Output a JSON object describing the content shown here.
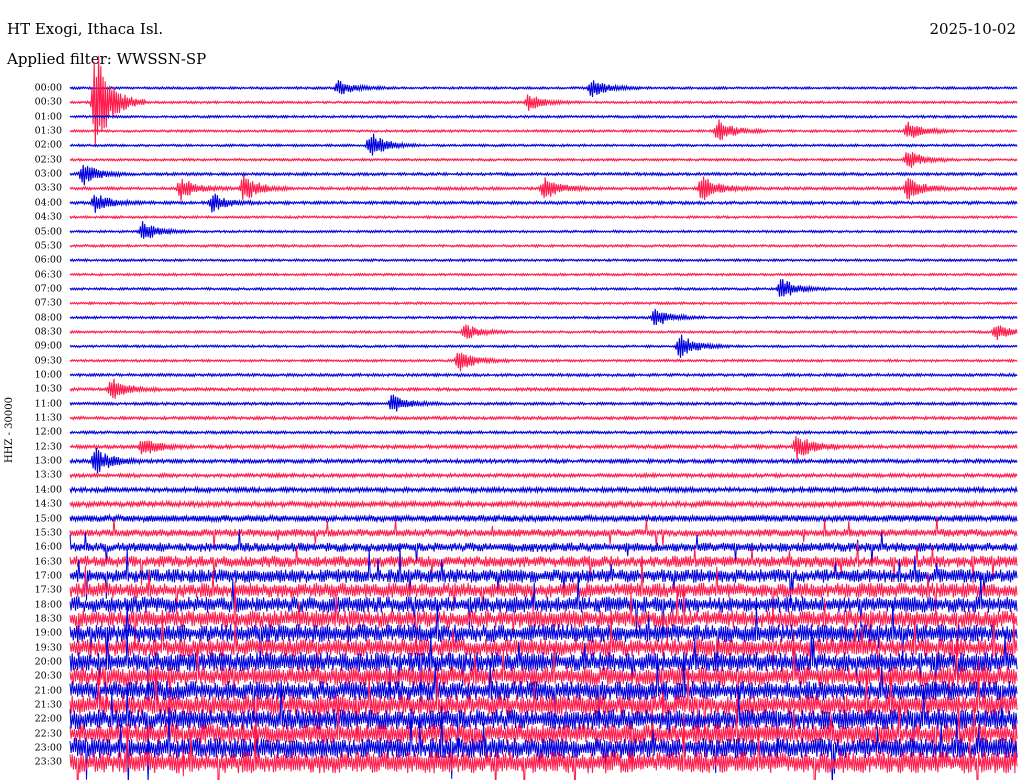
{
  "header": {
    "station": "HT Exogi, Ithaca Isl.",
    "date": "2025-10-02",
    "filter": "Applied filter: WWSSN-SP"
  },
  "channel_label": "HHZ - 30000",
  "colors": {
    "trace_a": "#0000dd",
    "trace_b": "#ff1a4a"
  },
  "chart_data": {
    "type": "line",
    "title": "HT Exogi, Ithaca Isl.",
    "x_axis": "minutes within each 30-minute line",
    "xlim": [
      0,
      30
    ],
    "line_labels": [
      "00:00",
      "00:30",
      "01:00",
      "01:30",
      "02:00",
      "02:30",
      "03:00",
      "03:30",
      "04:00",
      "04:30",
      "05:00",
      "05:30",
      "06:00",
      "06:30",
      "07:00",
      "07:30",
      "08:00",
      "08:30",
      "09:00",
      "09:30",
      "10:00",
      "10:30",
      "11:00",
      "11:30",
      "12:00",
      "12:30",
      "13:00",
      "13:30",
      "14:00",
      "14:30",
      "15:00",
      "15:30",
      "16:00",
      "16:30",
      "17:00",
      "17:30",
      "18:00",
      "18:30",
      "19:00",
      "19:30",
      "20:00",
      "20:30",
      "21:00",
      "21:30",
      "22:00",
      "22:30",
      "23:00",
      "23:30"
    ],
    "line_colors": [
      "trace_a",
      "trace_b"
    ],
    "noise_level": [
      1,
      1,
      1,
      1,
      1,
      1,
      1.2,
      1.3,
      1.3,
      1,
      1,
      1,
      1,
      1,
      1,
      1,
      1,
      1,
      1,
      1,
      1.2,
      1.3,
      1.2,
      1.3,
      1.2,
      1.5,
      1.6,
      1.6,
      2,
      2.3,
      2.8,
      3.3,
      4,
      5,
      6,
      6.5,
      7,
      7.5,
      8,
      8,
      8.5,
      8.5,
      8.5,
      9,
      9,
      9,
      9,
      9.5
    ],
    "events": [
      {
        "line": 0,
        "minute": 8.5,
        "amp": 8
      },
      {
        "line": 0,
        "minute": 16.5,
        "amp": 10
      },
      {
        "line": 1,
        "minute": 0.8,
        "amp": 60
      },
      {
        "line": 1,
        "minute": 14.5,
        "amp": 9
      },
      {
        "line": 3,
        "minute": 20.5,
        "amp": 12
      },
      {
        "line": 3,
        "minute": 26.5,
        "amp": 10
      },
      {
        "line": 4,
        "minute": 9.5,
        "amp": 14
      },
      {
        "line": 5,
        "minute": 26.5,
        "amp": 10
      },
      {
        "line": 6,
        "minute": 0.4,
        "amp": 12
      },
      {
        "line": 7,
        "minute": 3.5,
        "amp": 12
      },
      {
        "line": 7,
        "minute": 5.5,
        "amp": 14
      },
      {
        "line": 7,
        "minute": 15,
        "amp": 12
      },
      {
        "line": 7,
        "minute": 20,
        "amp": 14
      },
      {
        "line": 7,
        "minute": 26.5,
        "amp": 12
      },
      {
        "line": 8,
        "minute": 0.8,
        "amp": 10
      },
      {
        "line": 8,
        "minute": 4.5,
        "amp": 10
      },
      {
        "line": 10,
        "minute": 2.3,
        "amp": 10
      },
      {
        "line": 14,
        "minute": 22.5,
        "amp": 12
      },
      {
        "line": 16,
        "minute": 18.5,
        "amp": 10
      },
      {
        "line": 17,
        "minute": 12.5,
        "amp": 8
      },
      {
        "line": 17,
        "minute": 29.3,
        "amp": 9
      },
      {
        "line": 18,
        "minute": 19.3,
        "amp": 14
      },
      {
        "line": 19,
        "minute": 12.3,
        "amp": 12
      },
      {
        "line": 21,
        "minute": 1.3,
        "amp": 12
      },
      {
        "line": 22,
        "minute": 10.2,
        "amp": 10
      },
      {
        "line": 25,
        "minute": 2.3,
        "amp": 10
      },
      {
        "line": 25,
        "minute": 23,
        "amp": 14
      },
      {
        "line": 26,
        "minute": 0.8,
        "amp": 14
      }
    ]
  }
}
